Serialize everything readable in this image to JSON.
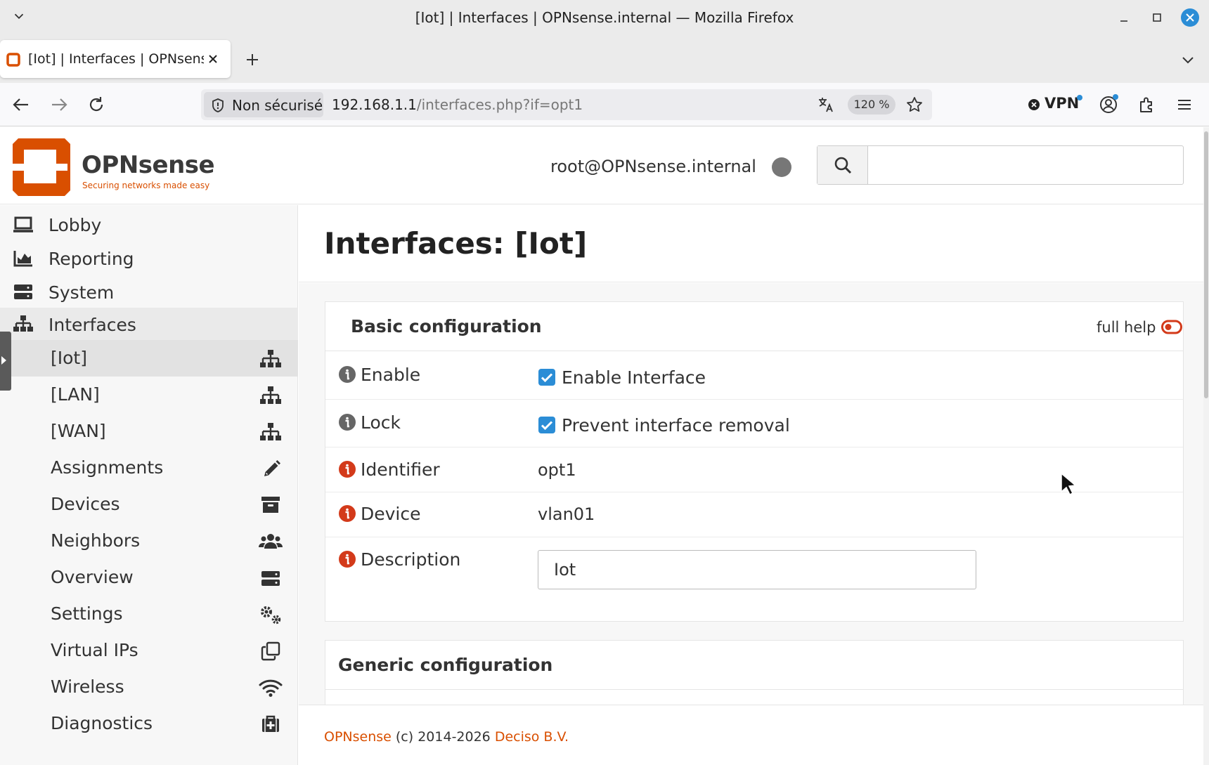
{
  "window": {
    "title": "[Iot] | Interfaces | OPNsense.internal — Mozilla Firefox"
  },
  "tabs": [
    {
      "title": "[Iot] | Interfaces | OPNsense.internal"
    }
  ],
  "navbar": {
    "security_label": "Non sécurisé",
    "url_host": "192.168.1.1",
    "url_path": "/interfaces.php?if=opt1",
    "zoom": "120 %",
    "vpn_label": "VPN"
  },
  "header": {
    "brand": "OPNsense",
    "tagline": "Securing networks made easy",
    "user": "root@OPNsense.internal",
    "search_placeholder": ""
  },
  "sidebar": {
    "top_items": [
      {
        "label": "Lobby",
        "icon": "laptop-icon"
      },
      {
        "label": "Reporting",
        "icon": "area-chart-icon"
      },
      {
        "label": "System",
        "icon": "server-icon"
      },
      {
        "label": "Interfaces",
        "icon": "sitemap-icon"
      }
    ],
    "sub_items": [
      {
        "label": "[Iot]",
        "icon": "sitemap-icon",
        "active": true
      },
      {
        "label": "[LAN]",
        "icon": "sitemap-icon"
      },
      {
        "label": "[WAN]",
        "icon": "sitemap-icon"
      },
      {
        "label": "Assignments",
        "icon": "pencil-icon"
      },
      {
        "label": "Devices",
        "icon": "archive-icon"
      },
      {
        "label": "Neighbors",
        "icon": "users-icon"
      },
      {
        "label": "Overview",
        "icon": "server-icon"
      },
      {
        "label": "Settings",
        "icon": "cogs-icon"
      },
      {
        "label": "Virtual IPs",
        "icon": "clone-icon"
      },
      {
        "label": "Wireless",
        "icon": "wifi-icon"
      },
      {
        "label": "Diagnostics",
        "icon": "medkit-icon"
      }
    ]
  },
  "main": {
    "title": "Interfaces: [Iot]",
    "basic": {
      "heading": "Basic configuration",
      "full_help": "full help",
      "enable_label": "Enable",
      "enable_checkbox": "Enable Interface",
      "lock_label": "Lock",
      "lock_checkbox": "Prevent interface removal",
      "identifier_label": "Identifier",
      "identifier_value": "opt1",
      "device_label": "Device",
      "device_value": "vlan01",
      "description_label": "Description",
      "description_value": "Iot"
    },
    "generic": {
      "heading": "Generic configuration"
    }
  },
  "footer": {
    "brand_link": "OPNsense",
    "copyright": " (c) 2014-2026 ",
    "company_link": "Deciso B.V."
  },
  "colors": {
    "accent_orange": "#d94f00",
    "checkbox_blue": "#2b8dd6",
    "info_red": "#d33a1a",
    "info_gray": "#666666"
  }
}
